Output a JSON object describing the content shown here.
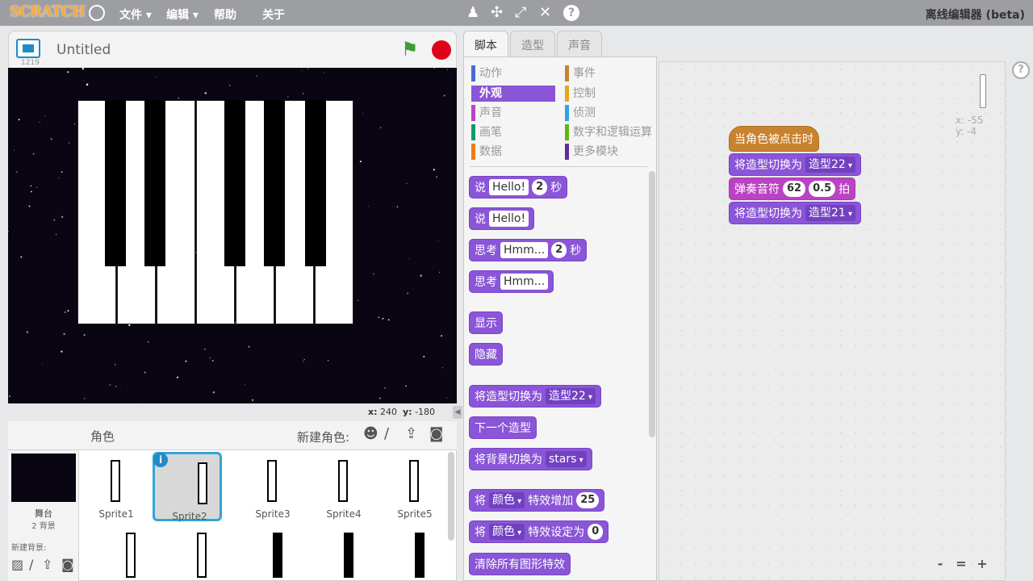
{
  "menubar": {
    "logo": "SCRATCH",
    "items": [
      "文件 ▾",
      "编辑 ▾",
      "帮助",
      "关于"
    ],
    "offline_label": "离线编辑器 (beta)",
    "tools": [
      "stamp-icon",
      "cut-icon",
      "grow-icon",
      "shrink-icon",
      "help-icon"
    ]
  },
  "stage": {
    "title": "Untitled",
    "version": "1219",
    "coord_x_label": "x:",
    "coord_x": "240",
    "coord_y_label": "y:",
    "coord_y": "-180"
  },
  "sprites": {
    "header": "角色",
    "new_sprite_label": "新建角色:",
    "stage_label": "舞台",
    "stage_backdrops": "2 背景",
    "new_backdrop_label": "新建背景:",
    "list": [
      "Sprite1",
      "Sprite2",
      "Sprite3",
      "Sprite4",
      "Sprite5"
    ],
    "selected": "Sprite2"
  },
  "tabs": [
    "脚本",
    "造型",
    "声音"
  ],
  "categories": {
    "left": [
      "动作",
      "外观",
      "声音",
      "画笔",
      "数据"
    ],
    "right": [
      "事件",
      "控制",
      "侦测",
      "数字和逻辑运算",
      "更多模块"
    ],
    "active": "外观",
    "colors": {
      "motion": "#4a6cd4",
      "looks": "#8a55d7",
      "sound": "#bb42c3",
      "pen": "#0e9a6c",
      "data": "#ee7d16",
      "events": "#c88330",
      "control": "#e1a91a",
      "sensing": "#2ca5e2",
      "operators": "#5cb712",
      "more": "#632d99"
    }
  },
  "palette_blocks": {
    "say_secs": {
      "label": "说",
      "text": "Hello!",
      "secs": "2",
      "unit": "秒"
    },
    "say": {
      "label": "说",
      "text": "Hello!"
    },
    "think_secs": {
      "label": "思考",
      "text": "Hmm...",
      "secs": "2",
      "unit": "秒"
    },
    "think": {
      "label": "思考",
      "text": "Hmm..."
    },
    "show": "显示",
    "hide": "隐藏",
    "switch_costume": {
      "label": "将造型切换为",
      "value": "造型22"
    },
    "next_costume": "下一个造型",
    "switch_backdrop": {
      "label": "将背景切换为",
      "value": "stars"
    },
    "change_effect": {
      "label1": "将",
      "effect": "颜色",
      "label2": "特效增加",
      "value": "25"
    },
    "set_effect": {
      "label1": "将",
      "effect": "颜色",
      "label2": "特效设定为",
      "value": "0"
    },
    "clear_effects": "清除所有图形特效"
  },
  "script": {
    "hat": "当角色被点击时",
    "block1": {
      "label": "将造型切换为",
      "value": "造型22"
    },
    "block2": {
      "label": "弹奏音符",
      "note": "62",
      "beats": "0.5",
      "unit": "拍"
    },
    "block3": {
      "label": "将造型切换为",
      "value": "造型21"
    },
    "coords_x": "x: -55",
    "coords_y": "y: -4"
  },
  "zoom": {
    "out": "-",
    "reset": "=",
    "in": "+"
  }
}
